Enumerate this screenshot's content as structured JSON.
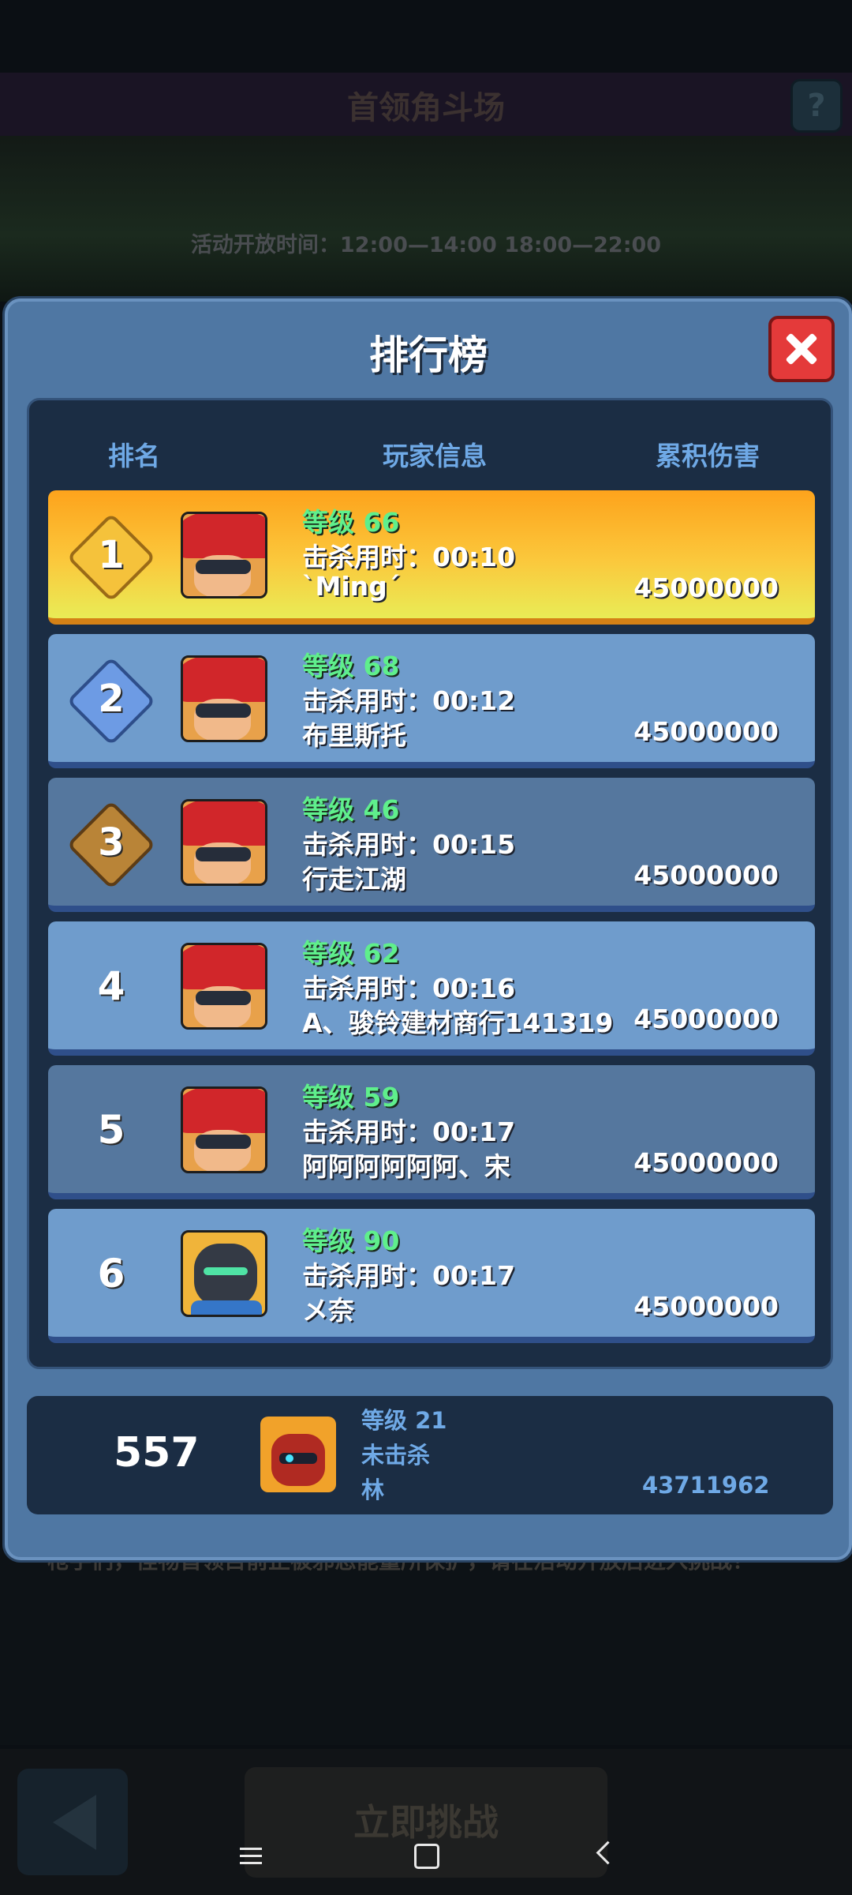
{
  "background": {
    "title": "首领角斗场",
    "help_label": "?",
    "open_time": "活动开放时间：12:00—14:00 18:00—22:00",
    "notice": "枪手们，怪物首领目前正被邪恶能量所保护，请在活动开放后进入挑战！",
    "challenge_button": "立即挑战"
  },
  "modal": {
    "title": "排行榜",
    "columns": {
      "rank": "排名",
      "player_info": "玩家信息",
      "damage": "累积伤害"
    },
    "rows": [
      {
        "rank": "1",
        "level": "等级 66",
        "kill_time": "击杀用时：00:10",
        "name": "ˋMingˊ",
        "damage": "45000000"
      },
      {
        "rank": "2",
        "level": "等级 68",
        "kill_time": "击杀用时：00:12",
        "name": "布里斯托",
        "damage": "45000000"
      },
      {
        "rank": "3",
        "level": "等级 46",
        "kill_time": "击杀用时：00:15",
        "name": "行走江湖",
        "damage": "45000000"
      },
      {
        "rank": "4",
        "level": "等级 62",
        "kill_time": "击杀用时：00:16",
        "name": "A、骏铃建材商行141319",
        "damage": "45000000"
      },
      {
        "rank": "5",
        "level": "等级 59",
        "kill_time": "击杀用时：00:17",
        "name": "阿阿阿阿阿阿、宋",
        "damage": "45000000"
      },
      {
        "rank": "6",
        "level": "等级 90",
        "kill_time": "击杀用时：00:17",
        "name": "メ奈",
        "damage": "45000000"
      }
    ],
    "me": {
      "rank": "557",
      "level": "等级 21",
      "kill_status": "未击杀",
      "name": "林",
      "damage": "43711962"
    }
  },
  "colors": {
    "accent": "#4f77a3",
    "close": "#e43a3a",
    "level_green": "#5fef8c"
  }
}
